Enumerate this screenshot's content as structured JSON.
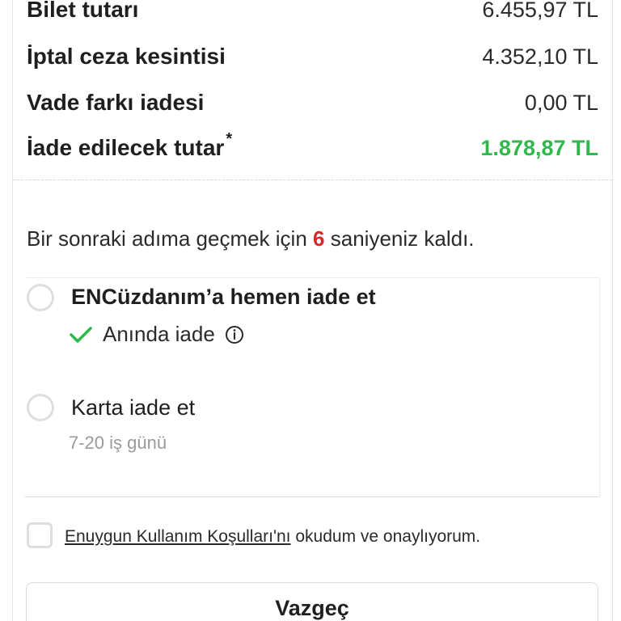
{
  "summary": {
    "rows": [
      {
        "label": "Bilet tutarı",
        "value": "6.455,97 TL"
      },
      {
        "label": "İptal ceza kesintisi",
        "value": "4.352,10 TL"
      },
      {
        "label": "Vade farkı iadesi",
        "value": "0,00 TL"
      }
    ],
    "total": {
      "label": "İade edilecek tutar",
      "asterisk": "*",
      "value": "1.878,87 TL",
      "color": "#2fb94a"
    }
  },
  "countdown": {
    "prefix": "Bir sonraki adıma geçmek için",
    "seconds": "6",
    "suffix": "saniyeniz kaldı.",
    "seconds_color": "#d62828"
  },
  "refund_options": [
    {
      "title": "ENCüzdanım’a hemen iade et",
      "subtitle": "Anında iade",
      "icons": [
        "check-icon",
        "info-icon"
      ],
      "selected": false
    },
    {
      "title": "Karta iade et",
      "note": "7-20 iş günü",
      "selected": false
    }
  ],
  "terms": {
    "link_text": "Enuygun Kullanım Koşulları'nı",
    "text": "okudum ve onaylıyorum.",
    "checked": false
  },
  "buttons": {
    "cancel_label": "Vazgeç"
  }
}
